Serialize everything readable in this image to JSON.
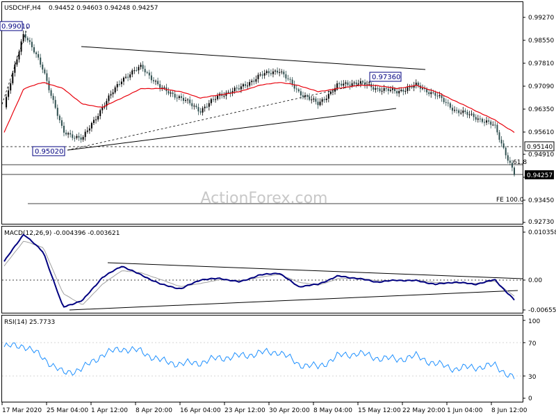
{
  "header": {
    "symbol": "USDCHF,H4",
    "ohlc": "0.94452 0.94603 0.94248 0.94257"
  },
  "watermark": "ActionForex.com",
  "price_panel": {
    "y_ticks": [
      "0.99270",
      "0.98550",
      "0.97810",
      "0.97090",
      "0.96350",
      "0.95610",
      "0.94910",
      "0.94190",
      "0.93450",
      "0.92730"
    ],
    "current_price_tag": "0.94257",
    "level_tag": "0.95140",
    "annotations": {
      "high": "0.99010",
      "low": "0.95020",
      "swing": "0.97360",
      "fib": "61.8",
      "fe": "FE 100.0"
    }
  },
  "macd_panel": {
    "title": "MACD(12,26,9) -0.004396 -0.003621",
    "y_ticks": [
      "0.010358",
      "0.00",
      "-0.006553"
    ]
  },
  "rsi_panel": {
    "title": "RSI(14) 25.7733",
    "y_ticks": [
      "100",
      "70",
      "30",
      "0"
    ]
  },
  "x_ticks": [
    "17 Mar 2020",
    "25 Mar 04:00",
    "1 Apr 12:00",
    "8 Apr 20:00",
    "16 Apr 04:00",
    "23 Apr 12:00",
    "30 Apr 20:00",
    "8 May 04:00",
    "15 May 12:00",
    "22 May 20:00",
    "1 Jun 04:00",
    "8 Jun 12:00"
  ],
  "colors": {
    "bull_candle": "#000000",
    "bear_candle": "#2f4f4f",
    "moving_average": "#e8000b",
    "macd_line": "#000080",
    "macd_signal": "#a0a0a0",
    "rsi_line": "#1e90ff",
    "trendline": "#000000"
  },
  "chart_data": [
    {
      "type": "candlestick",
      "title": "USDCHF,H4",
      "xlabel": "",
      "ylabel": "",
      "ylim": [
        0.9273,
        0.9927
      ],
      "x": [
        "17 Mar",
        "19 Mar",
        "21 Mar",
        "25 Mar",
        "27 Mar",
        "31 Mar",
        "2 Apr",
        "4 Apr",
        "8 Apr",
        "10 Apr",
        "14 Apr",
        "16 Apr",
        "20 Apr",
        "23 Apr",
        "27 Apr",
        "30 Apr",
        "4 May",
        "8 May",
        "12 May",
        "15 May",
        "19 May",
        "22 May",
        "27 May",
        "1 Jun",
        "4 Jun",
        "8 Jun",
        "10 Jun"
      ],
      "close": [
        0.964,
        0.988,
        0.976,
        0.956,
        0.954,
        0.964,
        0.973,
        0.977,
        0.97,
        0.967,
        0.963,
        0.968,
        0.97,
        0.974,
        0.976,
        0.969,
        0.965,
        0.971,
        0.972,
        0.97,
        0.969,
        0.971,
        0.968,
        0.963,
        0.961,
        0.958,
        0.9426
      ],
      "moving_average": [
        0.956,
        0.97,
        0.972,
        0.97,
        0.965,
        0.964,
        0.967,
        0.97,
        0.97,
        0.969,
        0.967,
        0.968,
        0.969,
        0.971,
        0.972,
        0.971,
        0.969,
        0.97,
        0.971,
        0.971,
        0.97,
        0.971,
        0.969,
        0.966,
        0.963,
        0.96,
        0.956
      ],
      "levels": {
        "resistance_line_start": 0.985,
        "resistance_line_end": 0.977,
        "support_line_start": 0.9502,
        "support_line_end": 0.964,
        "horizontal_1": 0.9514,
        "horizontal_2": 0.9475,
        "fe_100": 0.9345
      },
      "annotations": [
        "0.99010",
        "0.95020",
        "0.97360",
        "61.8",
        "FE 100.0",
        "0.95140",
        "0.94257"
      ]
    },
    {
      "type": "line",
      "title": "MACD(12,26,9) -0.004396 -0.003621",
      "ylim": [
        -0.0078,
        0.0104
      ],
      "series": [
        {
          "name": "MACD",
          "values": [
            0.004,
            0.01,
            0.006,
            -0.006,
            -0.0045,
            0.0005,
            0.003,
            0.001,
            -0.001,
            -0.002,
            0.0,
            0.0003,
            -0.0005,
            0.001,
            0.0015,
            -0.0015,
            -0.001,
            0.0008,
            0.0003,
            -0.0005,
            -0.0001,
            -0.0002,
            -0.001,
            -0.0005,
            -0.001,
            0.0,
            -0.0044
          ]
        },
        {
          "name": "Signal",
          "values": [
            0.003,
            0.0085,
            0.007,
            -0.003,
            -0.0055,
            -0.001,
            0.002,
            0.0015,
            0.0,
            -0.0015,
            -0.0008,
            0.0,
            -0.0002,
            0.0005,
            0.0012,
            -0.0005,
            -0.0012,
            0.0002,
            0.0004,
            -0.0002,
            -0.0002,
            -0.0001,
            -0.0006,
            -0.0007,
            -0.0008,
            -0.0003,
            -0.0036
          ]
        }
      ]
    },
    {
      "type": "line",
      "title": "RSI(14) 25.7733",
      "ylim": [
        0,
        100
      ],
      "series": [
        {
          "name": "RSI(14)",
          "values": [
            66,
            68,
            52,
            32,
            38,
            56,
            64,
            60,
            48,
            44,
            46,
            52,
            54,
            58,
            60,
            44,
            40,
            54,
            58,
            52,
            50,
            54,
            44,
            38,
            40,
            42,
            25.77
          ]
        }
      ]
    }
  ]
}
